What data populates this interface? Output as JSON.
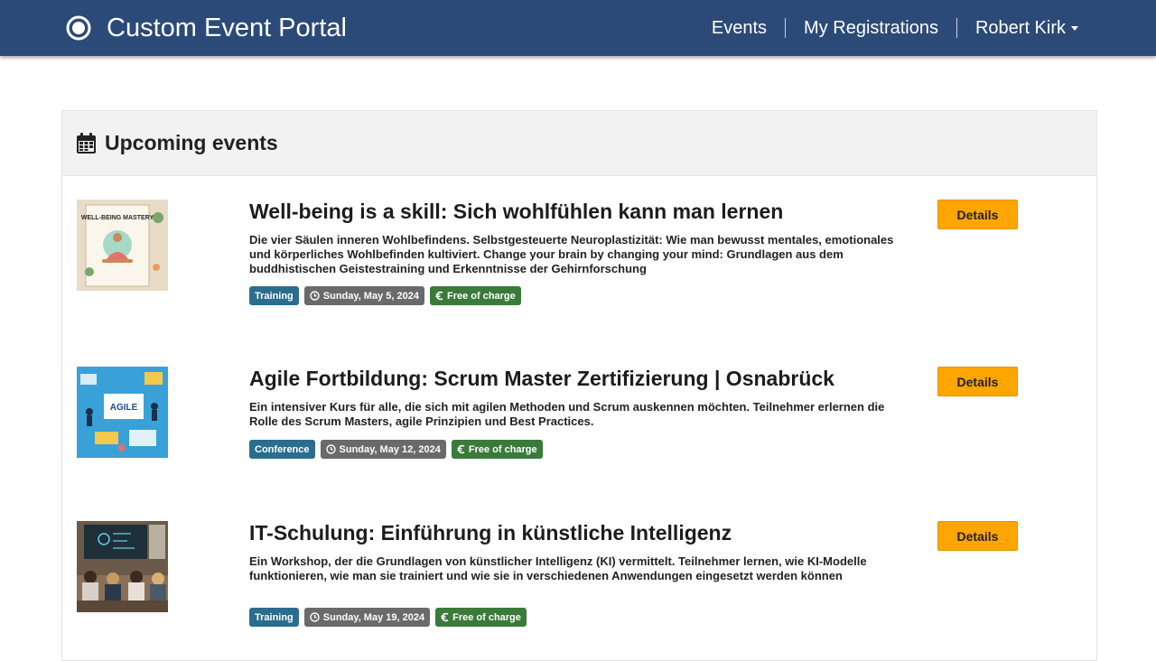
{
  "header": {
    "title": "Custom Event Portal",
    "nav": {
      "events": "Events",
      "registrations": "My Registrations",
      "user": "Robert Kirk"
    }
  },
  "panel": {
    "title": "Upcoming events"
  },
  "events": [
    {
      "title": "Well-being is a skill: Sich wohlfühlen kann man lernen",
      "description": "Die vier Säulen inneren Wohlbefindens. Selbstgesteuerte Neuroplastizität: Wie man bewusst mentales, emotionales und körperliches Wohlbefinden kultiviert. Change your brain by changing your mind: Grundlagen aus dem buddhistischen Geistestraining und Erkenntnisse der Gehirnforschung",
      "type": "Training",
      "date": "Sunday, May 5, 2024",
      "price": "Free of charge",
      "button": "Details",
      "thumb_text": "WELL-BEING MASTERY"
    },
    {
      "title": "Agile Fortbildung: Scrum Master Zertifizierung | Osnabrück",
      "description": "Ein intensiver Kurs für alle, die sich mit agilen Methoden und Scrum auskennen möchten. Teilnehmer erlernen die Rolle des Scrum Masters, agile Prinzipien und Best Practices.",
      "type": "Conference",
      "date": "Sunday, May 12, 2024",
      "price": "Free of charge",
      "button": "Details",
      "thumb_text": "AGILE"
    },
    {
      "title": "IT-Schulung: Einführung in künstliche Intelligenz",
      "description": "Ein Workshop, der die Grundlagen von künstlicher Intelligenz (KI) vermittelt. Teilnehmer lernen, wie KI-Modelle funktionieren, wie man sie trainiert und wie sie in verschiedenen Anwendungen eingesetzt werden können",
      "type": "Training",
      "date": "Sunday, May 19, 2024",
      "price": "Free of charge",
      "button": "Details",
      "thumb_text": ""
    }
  ],
  "colors": {
    "navbar": "#2c4a78",
    "accent_button": "#ffa500",
    "badge_type": "#2b6d8e",
    "badge_date": "#6a6a6a",
    "badge_price": "#3a7a3a"
  },
  "icons": {
    "logo": "brand-logo-icon",
    "calendar": "calendar-icon",
    "clock": "clock-icon",
    "euro": "euro-icon",
    "caret": "caret-down-icon"
  }
}
